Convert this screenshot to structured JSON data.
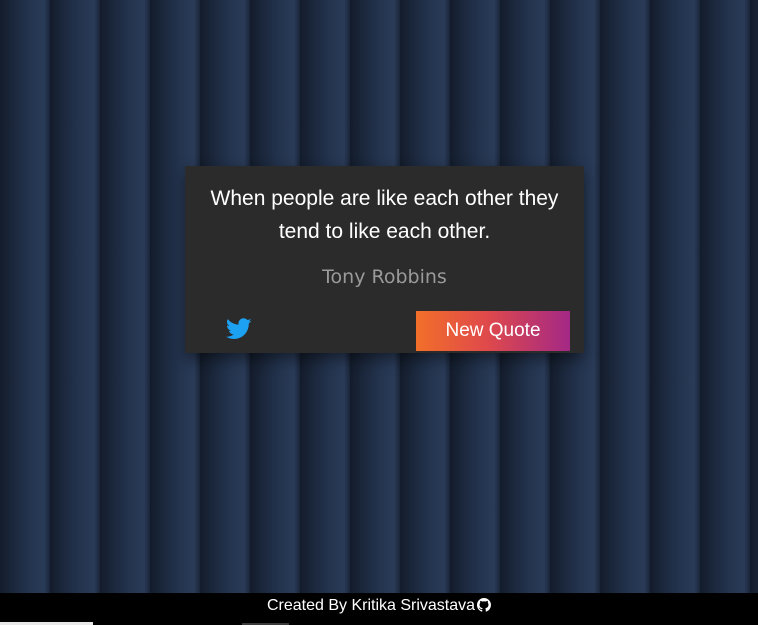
{
  "quote": {
    "text": "When people are like each other they tend to like each other.",
    "author": "Tony Robbins"
  },
  "actions": {
    "tweet_icon": "twitter-icon",
    "new_quote_label": "New Quote"
  },
  "footer": {
    "credit": "Created By Kritika Srivastava",
    "credit_icon": "github-icon"
  },
  "colors": {
    "card_background": "#2b2b2b",
    "author_text": "#9a9a9a",
    "twitter_blue": "#1da1f2",
    "button_gradient_start": "#f26f2a",
    "button_gradient_end": "#a42886",
    "footer_background": "#000000"
  }
}
